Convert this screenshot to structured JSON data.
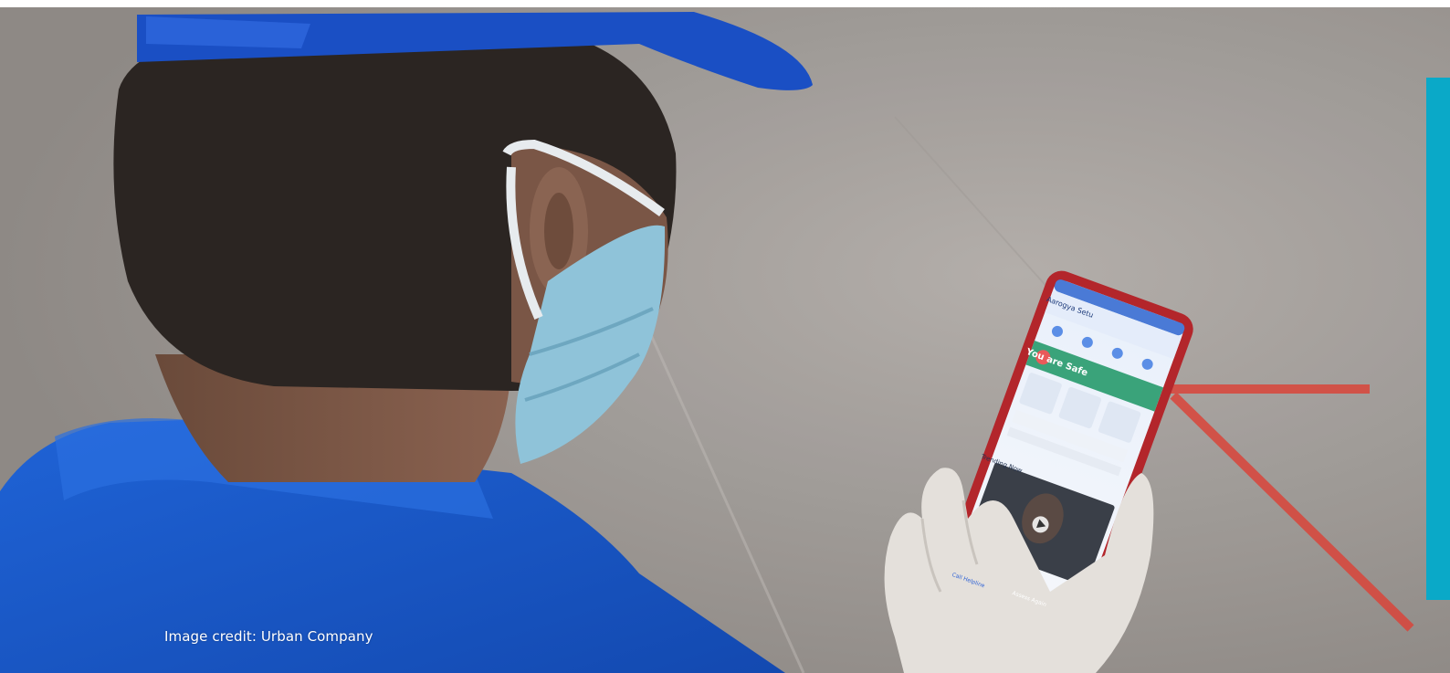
{
  "caption": {
    "credit": "Image credit: Urban Company"
  },
  "phone_screen": {
    "app_title": "Aarogya Setu",
    "status_banner": "You are Safe",
    "section_heading": "Trending Now",
    "call_button": "Call Helpline",
    "assess_button": "Assess Again"
  },
  "colors": {
    "accent_bar": "#0aa9c8",
    "cap_blue": "#1a4fc4",
    "shirt_blue": "#1e5fd0",
    "mask_blue": "#8fc3d9",
    "safe_green": "#3aa37a",
    "screen_blue": "#5b8ee6",
    "phone_red": "#b3262b",
    "floor_marking": "#d9443a"
  },
  "icons": [
    "video-play-icon",
    "share-icon",
    "phone-icon"
  ]
}
